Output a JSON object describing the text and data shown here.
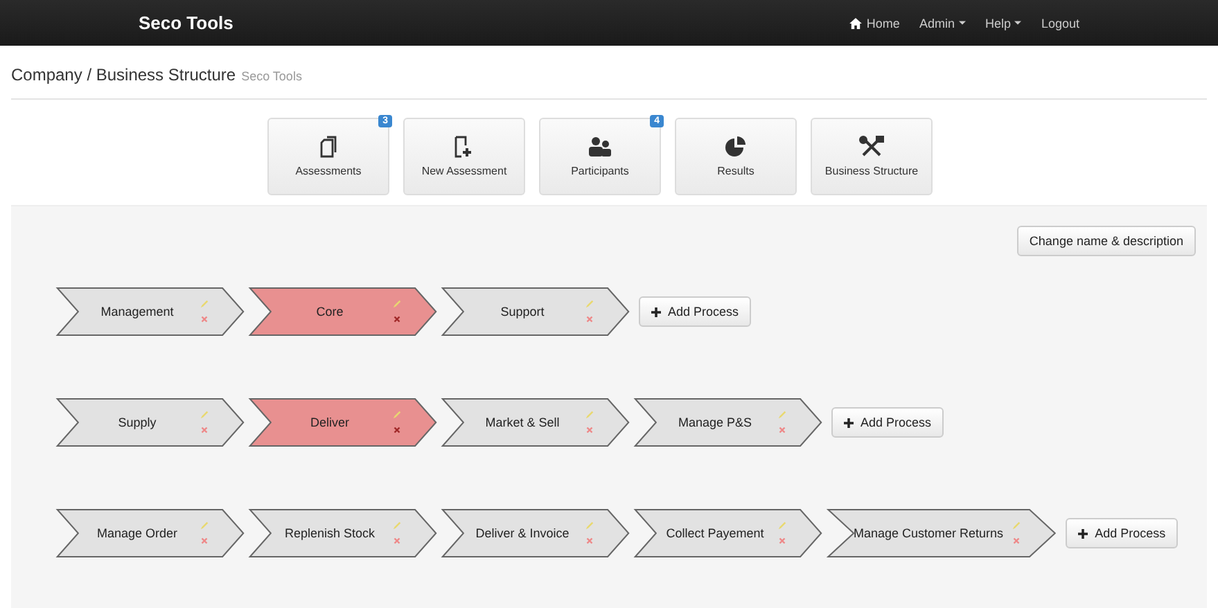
{
  "navbar": {
    "brand": "Seco Tools",
    "items": [
      {
        "label": "Home",
        "kind": "home"
      },
      {
        "label": "Admin",
        "kind": "dropdown"
      },
      {
        "label": "Help",
        "kind": "dropdown"
      },
      {
        "label": "Logout",
        "kind": "link"
      }
    ]
  },
  "header": {
    "title": "Company / Business Structure",
    "subtitle": "Seco Tools"
  },
  "tiles": [
    {
      "label": "Assessments",
      "kind": "documents",
      "badge": "3"
    },
    {
      "label": "New Assessment",
      "kind": "new-document"
    },
    {
      "label": "Participants",
      "kind": "users",
      "badge": "4"
    },
    {
      "label": "Results",
      "kind": "pie"
    },
    {
      "label": "Business Structure",
      "kind": "tools"
    }
  ],
  "change_button": "Change name & description",
  "rows": [
    {
      "processes": [
        {
          "label": "Management",
          "selected": false
        },
        {
          "label": "Core",
          "selected": true
        },
        {
          "label": "Support",
          "selected": false
        }
      ],
      "add_button": "Add Process"
    },
    {
      "processes": [
        {
          "label": "Supply",
          "selected": false
        },
        {
          "label": "Deliver",
          "selected": true
        },
        {
          "label": "Market & Sell",
          "selected": false
        },
        {
          "label": "Manage P&S",
          "selected": false
        }
      ],
      "add_button": "Add Process"
    },
    {
      "processes": [
        {
          "label": "Manage Order",
          "selected": false
        },
        {
          "label": "Replenish Stock",
          "selected": false
        },
        {
          "label": "Deliver & Invoice",
          "selected": false
        },
        {
          "label": "Collect Payement",
          "selected": false
        },
        {
          "label": "Manage Customer Returns",
          "selected": false
        }
      ],
      "add_button": "Add Process"
    }
  ]
}
